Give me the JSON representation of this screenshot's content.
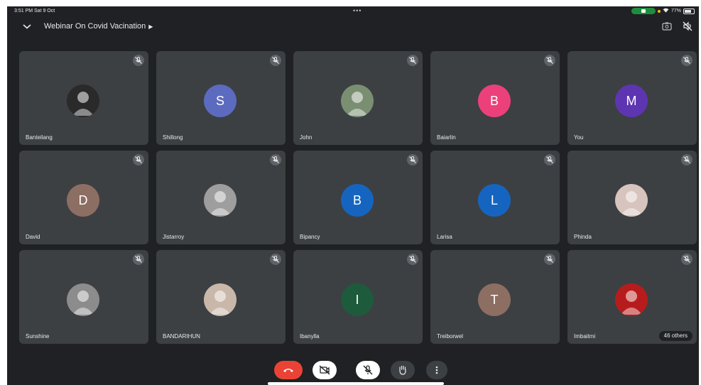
{
  "status": {
    "time_date": "3:51 PM  Sat 9 Oct",
    "battery_pct": "77%",
    "dots": "•••"
  },
  "meeting": {
    "title": "Webinar On Covid Vacination"
  },
  "participants": [
    {
      "name": "Banteilang",
      "initial": "",
      "avatar_type": "photo",
      "avatar_color": "#2a2a2a"
    },
    {
      "name": "Shillong",
      "initial": "S",
      "avatar_type": "letter",
      "avatar_color": "#5c6bc0"
    },
    {
      "name": "John",
      "initial": "",
      "avatar_type": "photo",
      "avatar_color": "#7a8f72"
    },
    {
      "name": "Baiarlin",
      "initial": "B",
      "avatar_type": "letter",
      "avatar_color": "#ec407a"
    },
    {
      "name": "You",
      "initial": "M",
      "avatar_type": "letter",
      "avatar_color": "#5e35b1"
    },
    {
      "name": "David",
      "initial": "D",
      "avatar_type": "letter",
      "avatar_color": "#8d6e63"
    },
    {
      "name": "Jistarroy",
      "initial": "",
      "avatar_type": "photo",
      "avatar_color": "#9e9e9e"
    },
    {
      "name": "Bipancy",
      "initial": "B",
      "avatar_type": "letter",
      "avatar_color": "#1565c0"
    },
    {
      "name": "Larisa",
      "initial": "L",
      "avatar_type": "letter",
      "avatar_color": "#1565c0"
    },
    {
      "name": "Phinda",
      "initial": "",
      "avatar_type": "photo",
      "avatar_color": "#d7c4be"
    },
    {
      "name": "Sunshine",
      "initial": "",
      "avatar_type": "photo",
      "avatar_color": "#8c8c8c"
    },
    {
      "name": "BANDARIHUN",
      "initial": "",
      "avatar_type": "photo",
      "avatar_color": "#c9b7a9"
    },
    {
      "name": "Ibanylla",
      "initial": "I",
      "avatar_type": "letter",
      "avatar_color": "#1e5a3c"
    },
    {
      "name": "Treiborwel",
      "initial": "T",
      "avatar_type": "letter",
      "avatar_color": "#8d6e63"
    },
    {
      "name": "Imbaitmi",
      "initial": "",
      "avatar_type": "photo",
      "avatar_color": "#b71c1c"
    }
  ],
  "others_badge": "46 others",
  "controls": [
    {
      "icon": "end-call-icon",
      "color": "#ea4335"
    },
    {
      "icon": "camera-off-icon",
      "color": "#ffffff"
    },
    {
      "icon": "mic-off-icon",
      "color": "#ffffff"
    },
    {
      "icon": "raise-hand-icon",
      "color": "#3c4043"
    },
    {
      "icon": "more-options-icon",
      "color": "#3c4043"
    }
  ]
}
